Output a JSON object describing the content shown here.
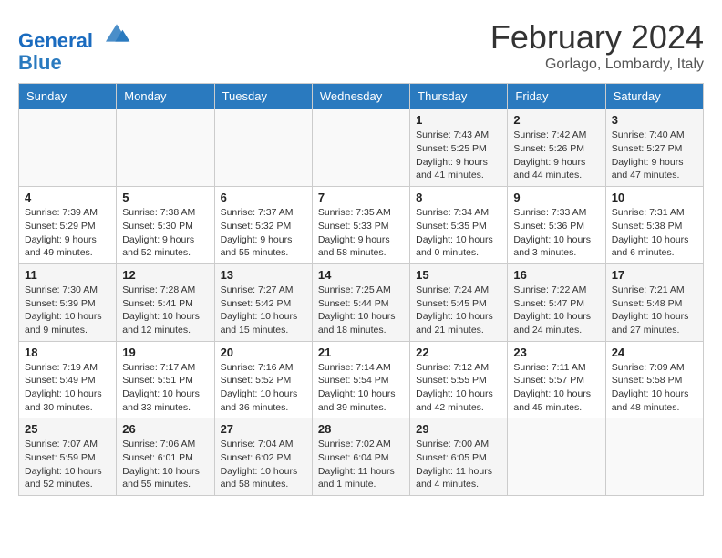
{
  "header": {
    "logo_line1": "General",
    "logo_line2": "Blue",
    "month": "February 2024",
    "location": "Gorlago, Lombardy, Italy"
  },
  "days_of_week": [
    "Sunday",
    "Monday",
    "Tuesday",
    "Wednesday",
    "Thursday",
    "Friday",
    "Saturday"
  ],
  "weeks": [
    [
      {
        "num": "",
        "info": ""
      },
      {
        "num": "",
        "info": ""
      },
      {
        "num": "",
        "info": ""
      },
      {
        "num": "",
        "info": ""
      },
      {
        "num": "1",
        "info": "Sunrise: 7:43 AM\nSunset: 5:25 PM\nDaylight: 9 hours\nand 41 minutes."
      },
      {
        "num": "2",
        "info": "Sunrise: 7:42 AM\nSunset: 5:26 PM\nDaylight: 9 hours\nand 44 minutes."
      },
      {
        "num": "3",
        "info": "Sunrise: 7:40 AM\nSunset: 5:27 PM\nDaylight: 9 hours\nand 47 minutes."
      }
    ],
    [
      {
        "num": "4",
        "info": "Sunrise: 7:39 AM\nSunset: 5:29 PM\nDaylight: 9 hours\nand 49 minutes."
      },
      {
        "num": "5",
        "info": "Sunrise: 7:38 AM\nSunset: 5:30 PM\nDaylight: 9 hours\nand 52 minutes."
      },
      {
        "num": "6",
        "info": "Sunrise: 7:37 AM\nSunset: 5:32 PM\nDaylight: 9 hours\nand 55 minutes."
      },
      {
        "num": "7",
        "info": "Sunrise: 7:35 AM\nSunset: 5:33 PM\nDaylight: 9 hours\nand 58 minutes."
      },
      {
        "num": "8",
        "info": "Sunrise: 7:34 AM\nSunset: 5:35 PM\nDaylight: 10 hours\nand 0 minutes."
      },
      {
        "num": "9",
        "info": "Sunrise: 7:33 AM\nSunset: 5:36 PM\nDaylight: 10 hours\nand 3 minutes."
      },
      {
        "num": "10",
        "info": "Sunrise: 7:31 AM\nSunset: 5:38 PM\nDaylight: 10 hours\nand 6 minutes."
      }
    ],
    [
      {
        "num": "11",
        "info": "Sunrise: 7:30 AM\nSunset: 5:39 PM\nDaylight: 10 hours\nand 9 minutes."
      },
      {
        "num": "12",
        "info": "Sunrise: 7:28 AM\nSunset: 5:41 PM\nDaylight: 10 hours\nand 12 minutes."
      },
      {
        "num": "13",
        "info": "Sunrise: 7:27 AM\nSunset: 5:42 PM\nDaylight: 10 hours\nand 15 minutes."
      },
      {
        "num": "14",
        "info": "Sunrise: 7:25 AM\nSunset: 5:44 PM\nDaylight: 10 hours\nand 18 minutes."
      },
      {
        "num": "15",
        "info": "Sunrise: 7:24 AM\nSunset: 5:45 PM\nDaylight: 10 hours\nand 21 minutes."
      },
      {
        "num": "16",
        "info": "Sunrise: 7:22 AM\nSunset: 5:47 PM\nDaylight: 10 hours\nand 24 minutes."
      },
      {
        "num": "17",
        "info": "Sunrise: 7:21 AM\nSunset: 5:48 PM\nDaylight: 10 hours\nand 27 minutes."
      }
    ],
    [
      {
        "num": "18",
        "info": "Sunrise: 7:19 AM\nSunset: 5:49 PM\nDaylight: 10 hours\nand 30 minutes."
      },
      {
        "num": "19",
        "info": "Sunrise: 7:17 AM\nSunset: 5:51 PM\nDaylight: 10 hours\nand 33 minutes."
      },
      {
        "num": "20",
        "info": "Sunrise: 7:16 AM\nSunset: 5:52 PM\nDaylight: 10 hours\nand 36 minutes."
      },
      {
        "num": "21",
        "info": "Sunrise: 7:14 AM\nSunset: 5:54 PM\nDaylight: 10 hours\nand 39 minutes."
      },
      {
        "num": "22",
        "info": "Sunrise: 7:12 AM\nSunset: 5:55 PM\nDaylight: 10 hours\nand 42 minutes."
      },
      {
        "num": "23",
        "info": "Sunrise: 7:11 AM\nSunset: 5:57 PM\nDaylight: 10 hours\nand 45 minutes."
      },
      {
        "num": "24",
        "info": "Sunrise: 7:09 AM\nSunset: 5:58 PM\nDaylight: 10 hours\nand 48 minutes."
      }
    ],
    [
      {
        "num": "25",
        "info": "Sunrise: 7:07 AM\nSunset: 5:59 PM\nDaylight: 10 hours\nand 52 minutes."
      },
      {
        "num": "26",
        "info": "Sunrise: 7:06 AM\nSunset: 6:01 PM\nDaylight: 10 hours\nand 55 minutes."
      },
      {
        "num": "27",
        "info": "Sunrise: 7:04 AM\nSunset: 6:02 PM\nDaylight: 10 hours\nand 58 minutes."
      },
      {
        "num": "28",
        "info": "Sunrise: 7:02 AM\nSunset: 6:04 PM\nDaylight: 11 hours\nand 1 minute."
      },
      {
        "num": "29",
        "info": "Sunrise: 7:00 AM\nSunset: 6:05 PM\nDaylight: 11 hours\nand 4 minutes."
      },
      {
        "num": "",
        "info": ""
      },
      {
        "num": "",
        "info": ""
      }
    ]
  ]
}
